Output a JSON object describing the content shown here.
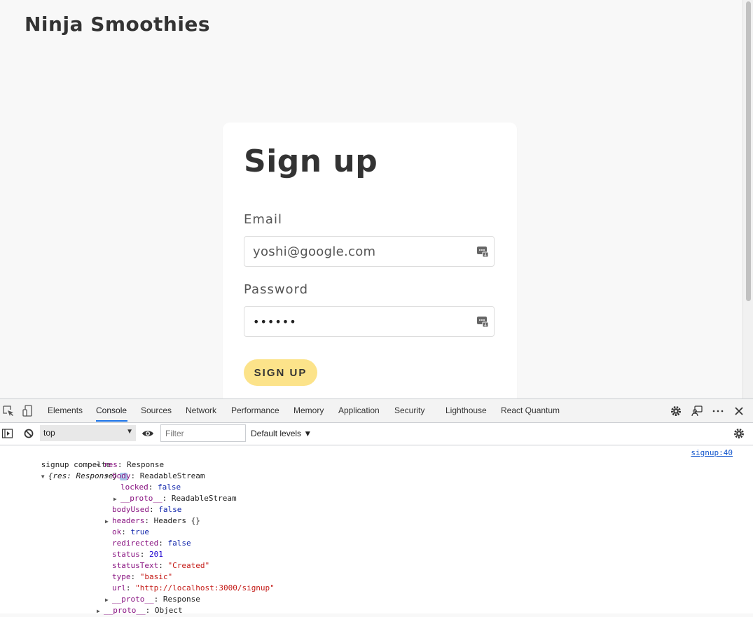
{
  "page": {
    "brand": "Ninja Smoothies",
    "form": {
      "title": "Sign up",
      "email_label": "Email",
      "email_value": "yoshi@google.com",
      "password_label": "Password",
      "password_value": "••••••",
      "submit_label": "SIGN UP",
      "button_color": "#fce38a"
    }
  },
  "devtools": {
    "tabs": [
      "Elements",
      "Console",
      "Sources",
      "Network",
      "Performance",
      "Memory",
      "Application",
      "Security",
      "Lighthouse",
      "React Quantum"
    ],
    "active_tab": "Console",
    "context": "top",
    "filter_placeholder": "Filter",
    "levels": "Default levels ▼",
    "source_link": "signup:40",
    "log": {
      "message": "signup compelte",
      "summary": "{res: Response}",
      "lines": [
        {
          "indent": 1,
          "toggle": "▼",
          "key": "res",
          "value": "Response",
          "type": "obj"
        },
        {
          "indent": 2,
          "toggle": "▼",
          "key": "body",
          "value": "ReadableStream",
          "type": "obj"
        },
        {
          "indent": 3,
          "toggle": "",
          "key": "locked",
          "value": "false",
          "type": "kw"
        },
        {
          "indent": 3,
          "toggle": "▶",
          "key": "__proto__",
          "value": "ReadableStream",
          "type": "obj"
        },
        {
          "indent": 2,
          "toggle": "",
          "key": "bodyUsed",
          "value": "false",
          "type": "kw"
        },
        {
          "indent": 2,
          "toggle": "▶",
          "key": "headers",
          "value": "Headers {}",
          "type": "obj"
        },
        {
          "indent": 2,
          "toggle": "",
          "key": "ok",
          "value": "true",
          "type": "kw"
        },
        {
          "indent": 2,
          "toggle": "",
          "key": "redirected",
          "value": "false",
          "type": "kw"
        },
        {
          "indent": 2,
          "toggle": "",
          "key": "status",
          "value": "201",
          "type": "num"
        },
        {
          "indent": 2,
          "toggle": "",
          "key": "statusText",
          "value": "\"Created\"",
          "type": "str"
        },
        {
          "indent": 2,
          "toggle": "",
          "key": "type",
          "value": "\"basic\"",
          "type": "str"
        },
        {
          "indent": 2,
          "toggle": "",
          "key": "url",
          "value": "\"http://localhost:3000/signup\"",
          "type": "str"
        },
        {
          "indent": 2,
          "toggle": "▶",
          "key": "__proto__",
          "value": "Response",
          "type": "obj"
        },
        {
          "indent": 1,
          "toggle": "▶",
          "key": "__proto__",
          "value": "Object",
          "type": "obj"
        }
      ]
    }
  }
}
